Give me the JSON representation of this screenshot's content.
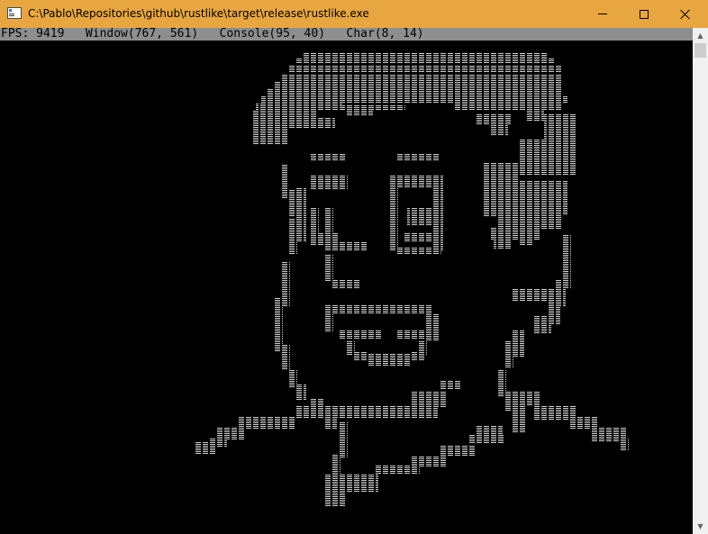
{
  "window": {
    "title": "C:\\Pablo\\Repositories\\github\\rustlike\\target\\release\\rustlike.exe",
    "icon": "console-app-icon",
    "controls": {
      "minimize": "minimize-icon",
      "maximize": "maximize-icon",
      "close": "close-icon"
    }
  },
  "status_bar": {
    "text": "FPS: 9419   Window(767, 561)   Console(95, 40)   Char(8, 14)"
  },
  "scrollbar": {
    "up_arrow": "▲",
    "down_arrow": "▼"
  },
  "colors": {
    "titlebar": "#e8a640",
    "console_bg": "#000000",
    "status_bg": "#8e8e8e",
    "art_fg": "#cfcfcf"
  },
  "art": {
    "glyph": "≡",
    "description_icon": "ascii-face-art"
  }
}
